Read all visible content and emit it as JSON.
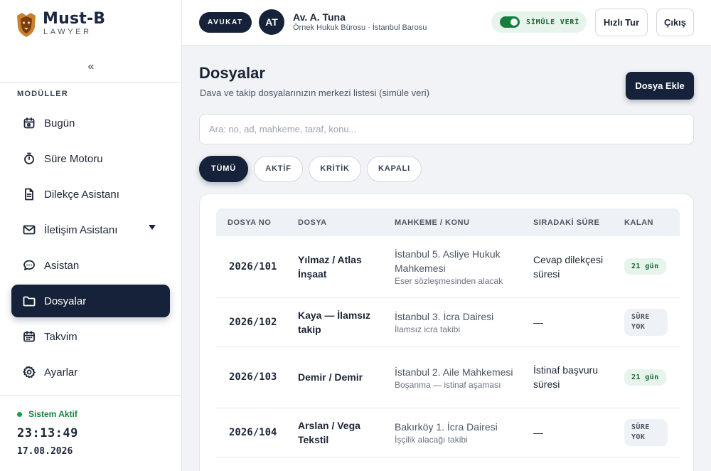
{
  "brand": {
    "name": "Must-B",
    "subtitle": "LAWYER"
  },
  "sidebar": {
    "collapse_label": "«",
    "section_title": "MODÜLLER",
    "items": [
      {
        "label": "Bugün",
        "icon": "calendar-today-icon"
      },
      {
        "label": "Süre Motoru",
        "icon": "stopwatch-icon"
      },
      {
        "label": "Dilekçe Asistanı",
        "icon": "document-icon"
      },
      {
        "label": "İletişim Asistanı",
        "icon": "mail-icon",
        "has_submenu": true
      },
      {
        "label": "Asistan",
        "icon": "chat-icon"
      },
      {
        "label": "Dosyalar",
        "icon": "folder-icon",
        "active": true
      },
      {
        "label": "Takvim",
        "icon": "calendar-icon"
      },
      {
        "label": "Ayarlar",
        "icon": "gear-icon"
      }
    ],
    "status": {
      "label": "Sistem Aktif",
      "time": "23:13:49",
      "date": "17.08.2026"
    }
  },
  "header": {
    "role": "AVUKAT",
    "avatar_initials": "AT",
    "user_name": "Av. A. Tuna",
    "user_org": "Örnek Hukuk Bürosu · İstanbul Barosu",
    "sim_toggle_label": "SİMÜLE VERİ",
    "sim_toggle_on": true,
    "tour_label": "Hızlı Tur",
    "logout_label": "Çıkış"
  },
  "main": {
    "title": "Dosyalar",
    "subtitle": "Dava ve takip dosyalarınızın merkezi listesi (simüle veri)",
    "add_label": "Dosya Ekle",
    "search_placeholder": "Ara: no, ad, mahkeme, taraf, konu...",
    "filters": [
      "TÜMÜ",
      "AKTİF",
      "KRİTİK",
      "KAPALI"
    ],
    "active_filter": "TÜMÜ",
    "table": {
      "columns": [
        "DOSYA NO",
        "DOSYA",
        "MAHKEME / KONU",
        "SIRADAKİ SÜRE",
        "KALAN"
      ],
      "rows": [
        {
          "no": "2026/101",
          "file": "Yılmaz / Atlas İnşaat",
          "court": "İstanbul 5. Asliye Hukuk Mahkemesi",
          "topic": "Eser sözleşmesinden alacak",
          "next": "Cevap dilekçesi süresi",
          "remaining": "21 gün",
          "status": "green"
        },
        {
          "no": "2026/102",
          "file": "Kaya — İlamsız takip",
          "court": "İstanbul 3. İcra Dairesi",
          "topic": "İlamsız icra takibi",
          "next": "—",
          "remaining": "SÜRE YOK",
          "status": "gray"
        },
        {
          "no": "2026/103",
          "file": "Demir / Demir",
          "court": "İstanbul 2. Aile Mahkemesi",
          "topic": "Boşanma — istinaf aşaması",
          "next": "İstinaf başvuru süresi",
          "remaining": "21 gün",
          "status": "green"
        },
        {
          "no": "2026/104",
          "file": "Arslan / Vega Tekstil",
          "court": "Bakırköy 1. İcra Dairesi",
          "topic": "İşçilik alacağı takibi",
          "next": "—",
          "remaining": "SÜRE YOK",
          "status": "gray"
        }
      ]
    }
  }
}
